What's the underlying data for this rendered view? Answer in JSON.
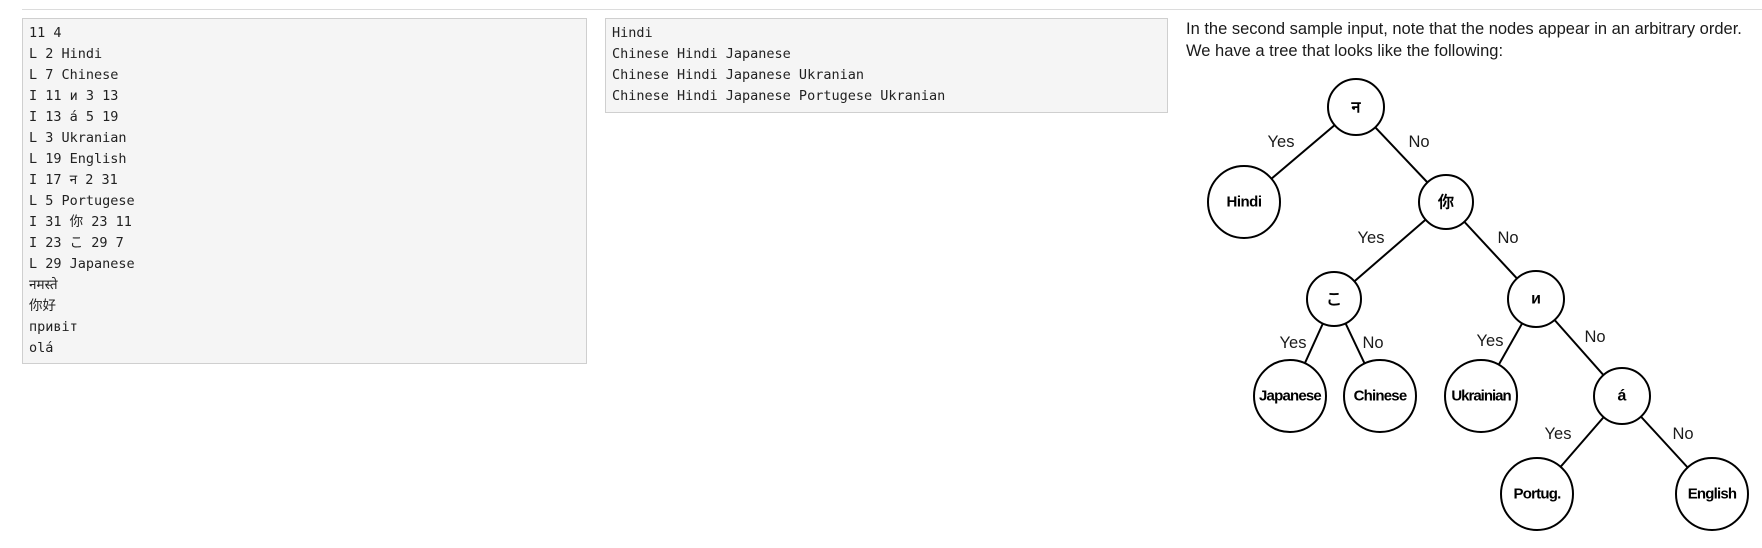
{
  "sample_input_lines": [
    "11 4",
    "L 2 Hindi",
    "L 7 Chinese",
    "I 11 и 3 13",
    "I 13 á 5 19",
    "L 3 Ukranian",
    "L 19 English",
    "I 17 न 2 31",
    "L 5 Portugese",
    "I 31 你 23 11",
    "I 23 こ 29 7",
    "L 29 Japanese",
    "नमस्ते",
    "你好",
    "привіт",
    "olá"
  ],
  "sample_output_lines": [
    "Hindi",
    "Chinese Hindi Japanese",
    "Chinese Hindi Japanese Ukranian",
    "Chinese Hindi Japanese Portugese Ukranian"
  ],
  "explanation": "In the second sample input, note that the nodes appear in an arbitrary order. We have a tree that looks like the following:",
  "tree": {
    "nodes": {
      "root": "न",
      "hindi": "Hindi",
      "ni": "你",
      "ko": "こ",
      "i": "и",
      "japanese": "Japanese",
      "chinese": "Chinese",
      "ukrainian": "Ukrainian",
      "a": "á",
      "portug": "Portug.",
      "english": "English"
    },
    "yes_label": "Yes",
    "no_label": "No"
  }
}
